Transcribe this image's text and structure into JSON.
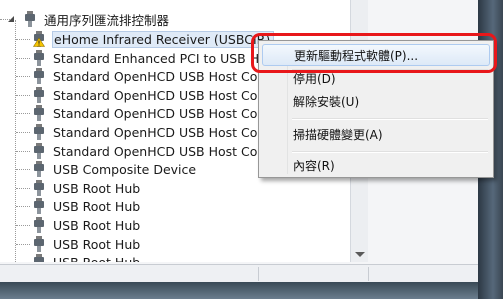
{
  "tree": {
    "category_label": "通用序列匯流排控制器",
    "devices": [
      {
        "label": "eHome Infrared Receiver (USBCIR)",
        "icon": "warning-device-icon",
        "selected": true
      },
      {
        "label": "Standard Enhanced PCI to USB Hos",
        "icon": "usb-plug-icon"
      },
      {
        "label": "Standard OpenHCD USB Host Con",
        "icon": "usb-plug-icon"
      },
      {
        "label": "Standard OpenHCD USB Host Con",
        "icon": "usb-plug-icon"
      },
      {
        "label": "Standard OpenHCD USB Host Con",
        "icon": "usb-plug-icon"
      },
      {
        "label": "Standard OpenHCD USB Host Con",
        "icon": "usb-plug-icon"
      },
      {
        "label": "Standard OpenHCD USB Host Con",
        "icon": "usb-plug-icon"
      },
      {
        "label": "USB Composite Device",
        "icon": "usb-plug-icon"
      },
      {
        "label": "USB Root Hub",
        "icon": "usb-plug-icon"
      },
      {
        "label": "USB Root Hub",
        "icon": "usb-plug-icon"
      },
      {
        "label": "USB Root Hub",
        "icon": "usb-plug-icon"
      },
      {
        "label": "USB Root Hub",
        "icon": "usb-plug-icon"
      },
      {
        "label": "USB Root Hub",
        "icon": "usb-plug-icon"
      }
    ]
  },
  "context_menu": {
    "items": [
      {
        "label": "更新驅動程式軟體(P)...",
        "highlighted": true
      },
      {
        "label": "停用(D)"
      },
      {
        "label": "解除安裝(U)"
      },
      {
        "label": "掃描硬體變更(A)"
      },
      {
        "label": "內容(R)"
      }
    ]
  },
  "colors": {
    "highlight_border": "#e8171a",
    "selection_fill": "#dfeaf7",
    "warning_yellow": "#f5c400"
  }
}
